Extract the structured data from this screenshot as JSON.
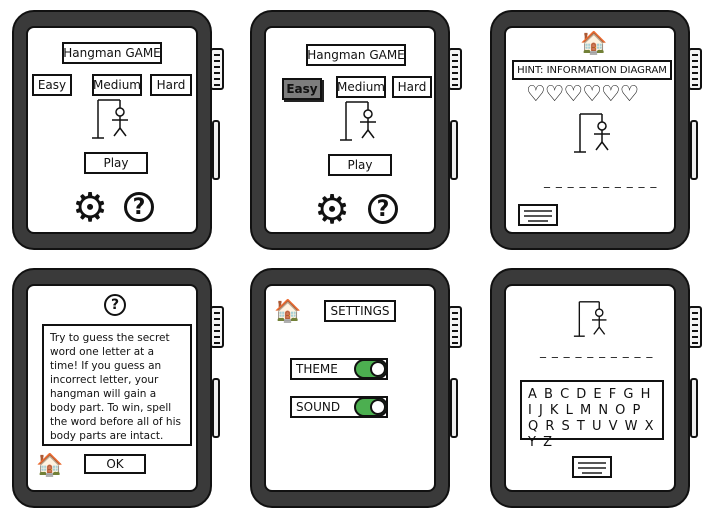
{
  "screens": {
    "menu1": {
      "title": "Hangman GAME",
      "difficulties": [
        "Easy",
        "Medium",
        "Hard"
      ],
      "play": "Play"
    },
    "menu2": {
      "title": "Hangman GAME",
      "difficulties": [
        "Easy",
        "Medium",
        "Hard"
      ],
      "selected": "Easy",
      "play": "Play"
    },
    "game": {
      "hint": "HINT: INFORMATION DIAGRAM",
      "hearts": 6,
      "blanks": "_ _ _ _ _   _ _ _ _ _"
    },
    "help": {
      "help_icon": "?",
      "text": "Try to guess the secret word one letter at a time! If you guess an incorrect letter, your hangman will gain a body part. To win, spell the word before all of his body parts are intact.",
      "ok": "OK"
    },
    "settings": {
      "title": "SETTINGS",
      "theme": "THEME",
      "sound": "SOUND",
      "theme_on": true,
      "sound_on": true,
      "toggle_color": "#4caf50"
    },
    "keyboard": {
      "blanks": "_ _ _ _ _   _ _ _ _ _",
      "letters": "A B C D E F G H I J K L M N O P Q R S T U V W X Y Z"
    }
  },
  "icons": {
    "gear": "gear-icon",
    "help": "help-icon",
    "home": "home-icon",
    "keyboard": "keyboard-icon",
    "heart": "heart-icon"
  },
  "glyphs": {
    "gear": "⚙",
    "help": "?",
    "home": "🏠",
    "heart": "♡"
  }
}
